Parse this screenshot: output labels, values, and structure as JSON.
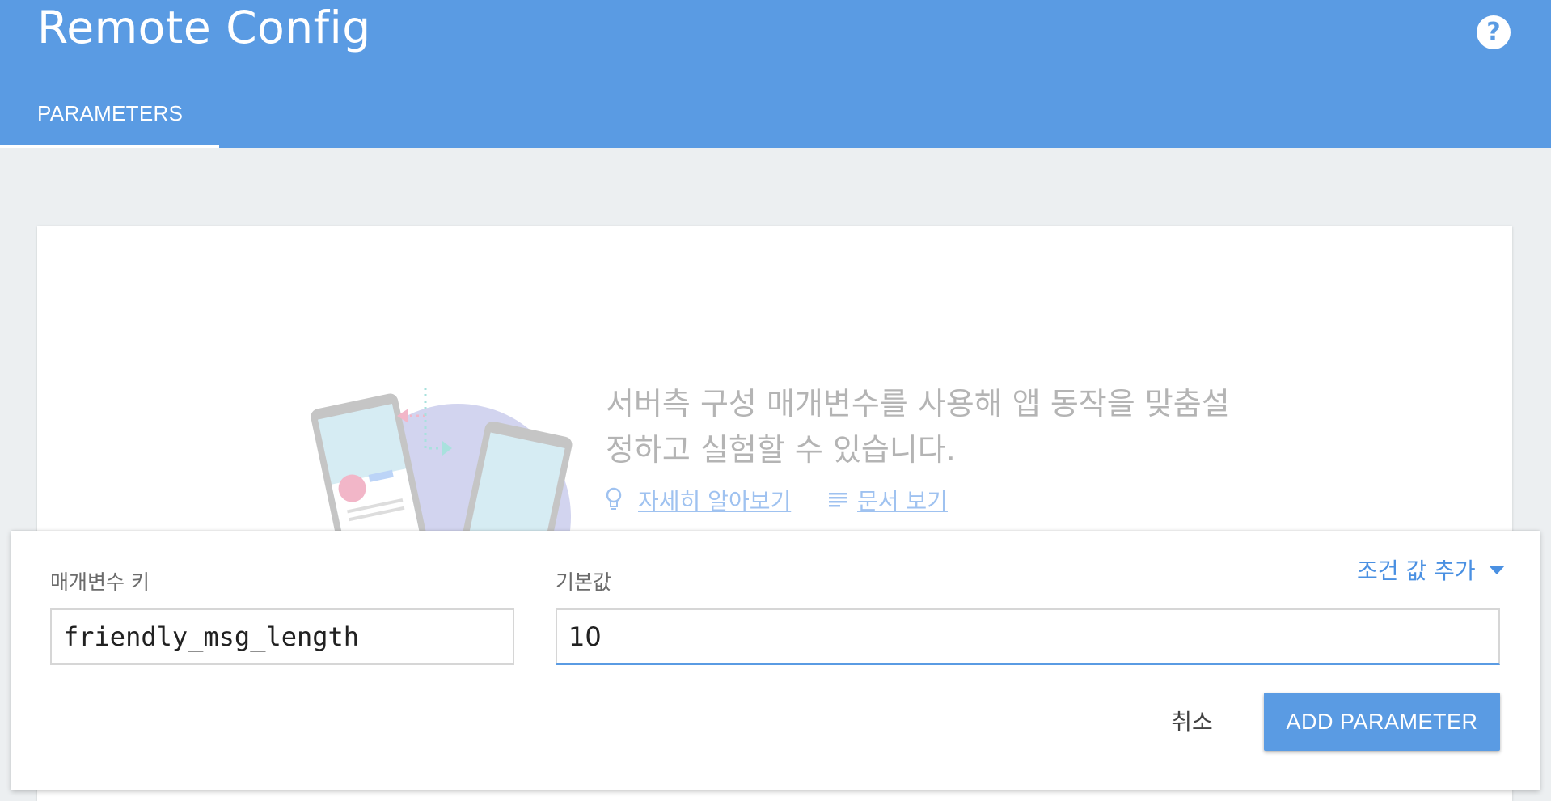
{
  "header": {
    "title": "Remote Config",
    "help_icon": "help-circle-icon",
    "help_glyph": "?",
    "tabs": [
      {
        "label": "PARAMETERS",
        "active": true
      }
    ]
  },
  "empty_state": {
    "line1": "서버측 구성 매개변수를 사용해 앱 동작을 맞춤설",
    "line2": "정하고 실험할 수 있습니다.",
    "learn_more_label": "자세히 알아보기",
    "learn_more_icon": "lightbulb-icon",
    "docs_label": "문서 보기",
    "docs_icon": "document-lines-icon"
  },
  "parameter_form": {
    "key_label": "매개변수 키",
    "key_value": "friendly_msg_length",
    "default_label": "기본값",
    "default_value": "10",
    "add_condition_label": "조건 값 추가",
    "add_condition_icon": "caret-down-icon",
    "cancel_label": "취소",
    "submit_label": "ADD PARAMETER"
  },
  "colors": {
    "accent": "#5a9be3",
    "link": "#4a90e2",
    "background": "#eceff1"
  }
}
